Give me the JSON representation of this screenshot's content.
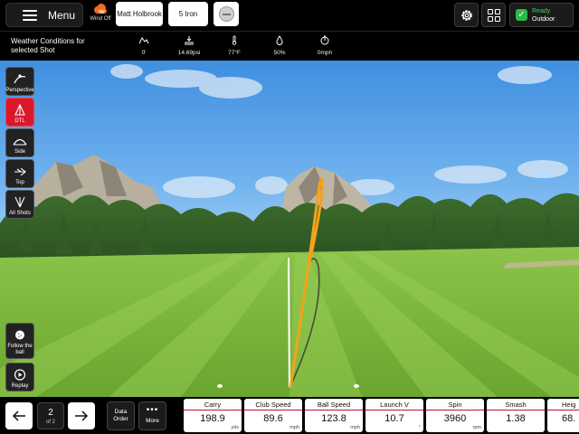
{
  "topbar": {
    "menu_label": "Menu",
    "wind_label": "Wind Off",
    "player": "Matt Holbrook",
    "club": "5 Iron",
    "status_ready": "Ready",
    "status_mode": "Outdoor",
    "accent_color": "#d8192b",
    "ready_color": "#2db84c"
  },
  "weather": {
    "title": "Weather Conditions for selected Shot",
    "items": [
      {
        "icon": "altitude-icon",
        "value": "0'"
      },
      {
        "icon": "pressure-icon",
        "value": "14.69psi"
      },
      {
        "icon": "thermometer-icon",
        "value": "77°F"
      },
      {
        "icon": "humidity-icon",
        "value": "50%"
      },
      {
        "icon": "wind-speed-icon",
        "value": "0mph"
      }
    ]
  },
  "views": [
    {
      "label": "Perspective",
      "icon": "perspective-icon",
      "active": false
    },
    {
      "label": "DTL",
      "icon": "dtl-icon",
      "active": true
    },
    {
      "label": "Side",
      "icon": "side-view-icon",
      "active": false
    },
    {
      "label": "Top",
      "icon": "top-view-icon",
      "active": false
    },
    {
      "label": "All Shots",
      "icon": "all-shots-icon",
      "active": false
    }
  ],
  "playback": {
    "follow_label": "Follow the ball",
    "replay_label": "Replay"
  },
  "bottombar": {
    "shot_number": "2",
    "shot_of": "of 2",
    "data_order_label": "Data Order",
    "more_label": "More"
  },
  "metrics": [
    {
      "name": "Carry",
      "value": "198.9",
      "unit": "yds"
    },
    {
      "name": "Club Speed",
      "value": "89.6",
      "unit": "mph"
    },
    {
      "name": "Ball Speed",
      "value": "123.8",
      "unit": "mph"
    },
    {
      "name": "Launch V",
      "value": "10.7",
      "unit": "°"
    },
    {
      "name": "Spin",
      "value": "3960",
      "unit": "rpm"
    },
    {
      "name": "Smash",
      "value": "1.38",
      "unit": ""
    },
    {
      "name": "Heig",
      "value": "68.",
      "unit": ""
    }
  ]
}
